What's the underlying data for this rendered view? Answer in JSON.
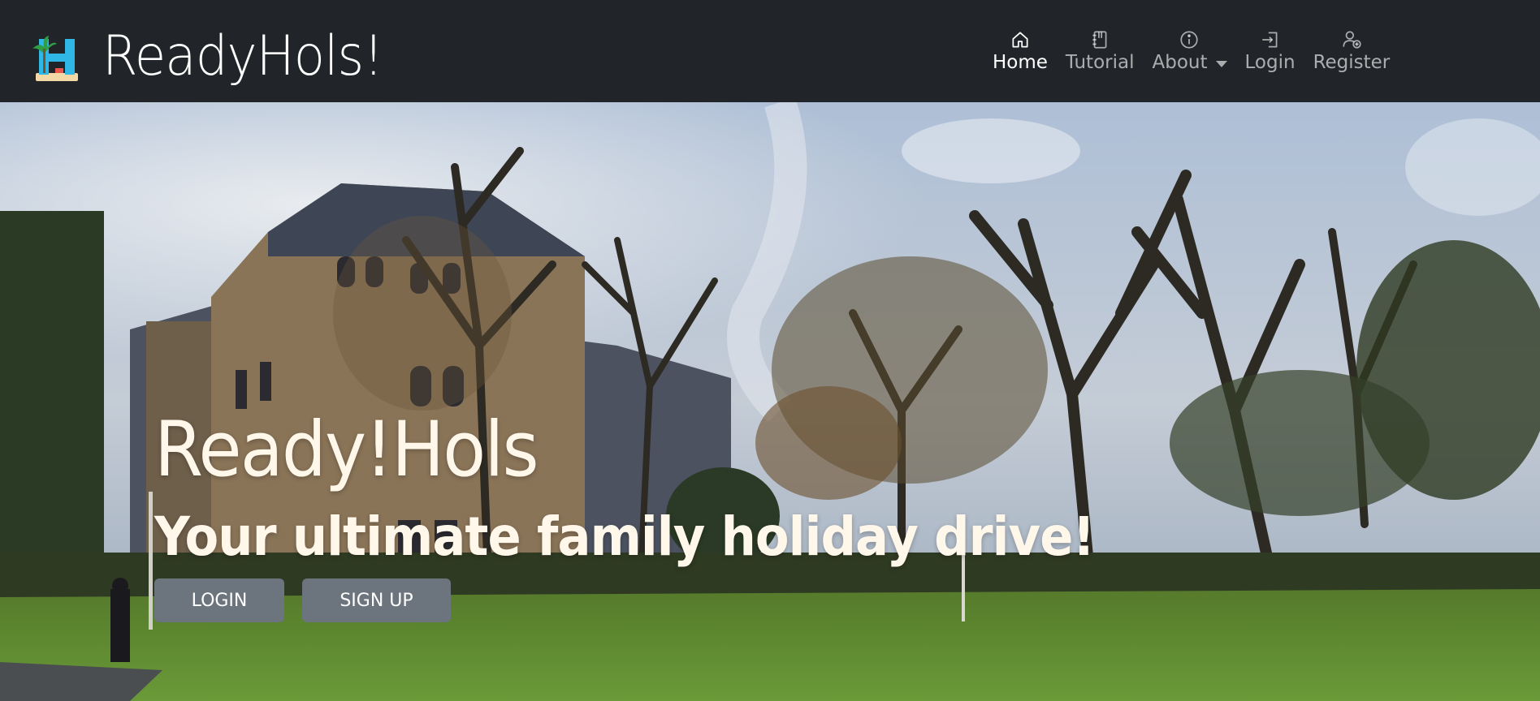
{
  "brand": {
    "name": "ReadyHols!",
    "logo_icon": "palm-beach-h-logo"
  },
  "nav": {
    "items": [
      {
        "label": "Home",
        "icon": "house-icon",
        "active": true
      },
      {
        "label": "Tutorial",
        "icon": "notebook-icon",
        "active": false
      },
      {
        "label": "About",
        "icon": "info-icon",
        "active": false,
        "dropdown": true
      },
      {
        "label": "Login",
        "icon": "login-icon",
        "active": false
      },
      {
        "label": "Register",
        "icon": "add-user-icon",
        "active": false
      }
    ]
  },
  "hero": {
    "title": "Ready!Hols",
    "subtitle": "Your ultimate family holiday drive!",
    "buttons": {
      "login": "LOGIN",
      "signup": "SIGN UP"
    }
  },
  "colors": {
    "navbar_bg": "#212529",
    "button_bg": "#6c757d",
    "hero_text": "#fff7ea"
  }
}
